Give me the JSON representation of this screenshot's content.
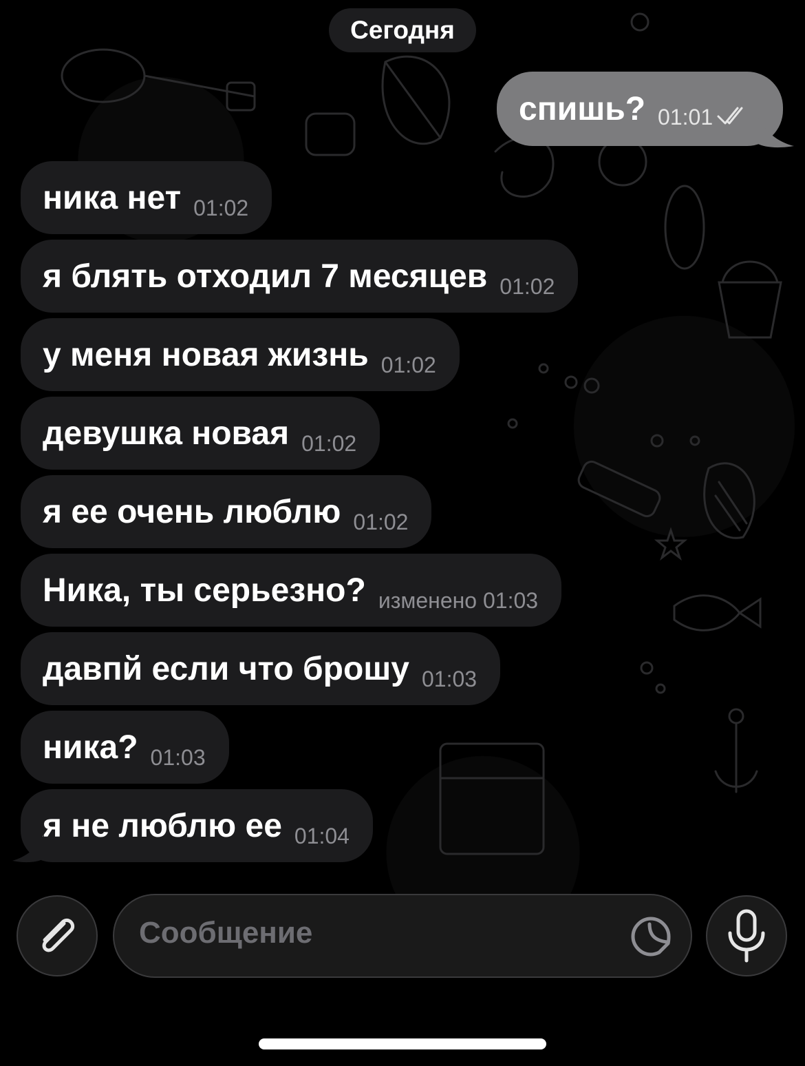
{
  "chat": {
    "date_label": "Сегодня",
    "outgoing": [
      {
        "text": "спишь?",
        "time": "01:01",
        "status": "read"
      }
    ],
    "incoming": [
      {
        "text": "ника нет",
        "time": "01:02"
      },
      {
        "text": "я блять отходил 7 месяцев",
        "time": "01:02"
      },
      {
        "text": "у меня новая жизнь",
        "time": "01:02"
      },
      {
        "text": "девушка новая",
        "time": "01:02"
      },
      {
        "text": "я ее очень люблю",
        "time": "01:02"
      },
      {
        "text": "Ника, ты серьезно?",
        "time": "изменено 01:03"
      },
      {
        "text": "давпй если что брошу",
        "time": "01:03"
      },
      {
        "text": "ника?",
        "time": "01:03"
      },
      {
        "text": "я не люблю ее",
        "time": "01:04"
      }
    ]
  },
  "composer": {
    "placeholder": "Сообщение",
    "attach_icon": "paperclip-icon",
    "sticker_icon": "sticker-icon",
    "mic_icon": "microphone-icon"
  },
  "colors": {
    "background": "#000000",
    "incoming_bubble": "#1c1c1e",
    "outgoing_bubble": "#7c7c7e",
    "time_text": "#8e8e93"
  }
}
